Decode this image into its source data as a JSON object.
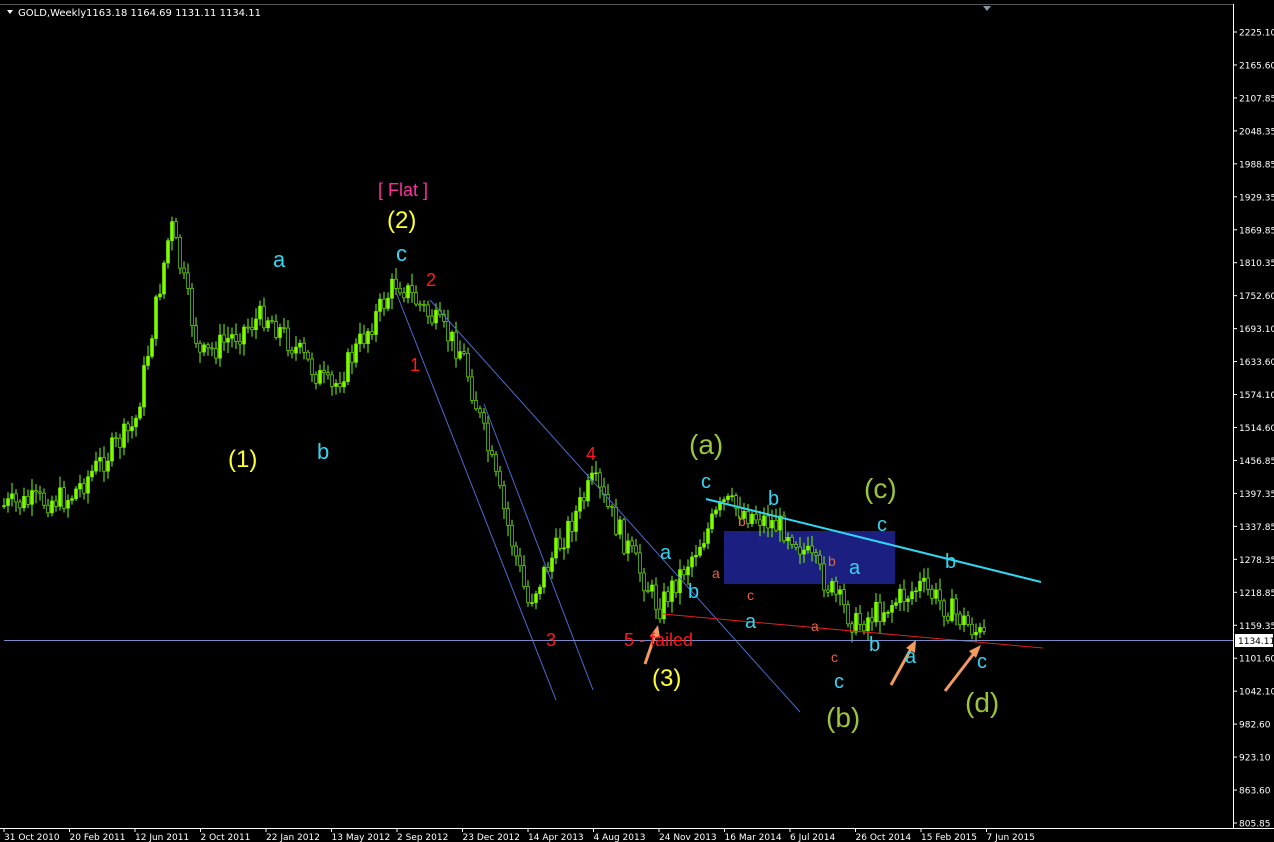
{
  "window": {
    "symbol_label": "GOLD,Weekly",
    "ohlc_label": "1163.18 1164.69 1131.11 1134.11"
  },
  "colors": {
    "background": "#000000",
    "candles": "#7CFC00",
    "axis": "#FFFFFF",
    "cyan": "#33D6F2",
    "red": "#FF1A1A",
    "yellow": "#FFFF33",
    "olive": "#9BC53D",
    "pink": "#FF2FA0",
    "orange": "#F29A5F",
    "blue_line": "#4A6CD0",
    "channel_fill": "#1A1F80",
    "price_line": "#7A8CC8"
  },
  "chart_data": {
    "type": "candlestick",
    "title": "GOLD,Weekly",
    "y_axis": {
      "ticks": [
        "2225.10",
        "2165.60",
        "2107.85",
        "2048.35",
        "1988.85",
        "1929.35",
        "1869.85",
        "1810.35",
        "1752.60",
        "1693.10",
        "1633.60",
        "1574.10",
        "1514.60",
        "1456.85",
        "1397.35",
        "1337.85",
        "1278.35",
        "1218.85",
        "1159.35",
        "1101.60",
        "1042.10",
        "982.60",
        "923.10",
        "863.60",
        "805.85"
      ],
      "ylim": [
        805.85,
        2225.1
      ]
    },
    "x_axis": {
      "ticks": [
        "31 Oct 2010",
        "20 Feb 2011",
        "12 Jun 2011",
        "2 Oct 2011",
        "22 Jan 2012",
        "13 May 2012",
        "2 Sep 2012",
        "23 Dec 2012",
        "14 Apr 2013",
        "4 Aug 2013",
        "24 Nov 2013",
        "16 Mar 2014",
        "6 Jul 2014",
        "26 Oct 2014",
        "15 Feb 2015",
        "7 Jun 2015"
      ]
    },
    "current_price": "1134.11",
    "price_path": [
      {
        "date": "31 Oct 2010",
        "close": 1375
      },
      {
        "date": "20 Feb 2011",
        "close": 1390
      },
      {
        "date": "12 Jun 2011",
        "close": 1520
      },
      {
        "date": "Sep 2011",
        "close": 1880
      },
      {
        "date": "2 Oct 2011",
        "close": 1640
      },
      {
        "date": "22 Jan 2012",
        "close": 1720
      },
      {
        "date": "13 May 2012",
        "close": 1580
      },
      {
        "date": "2 Sep 2012",
        "close": 1780
      },
      {
        "date": "23 Dec 2012",
        "close": 1650
      },
      {
        "date": "14 Apr 2013",
        "close": 1200
      },
      {
        "date": "4 Aug 2013",
        "close": 1420
      },
      {
        "date": "24 Nov 2013",
        "close": 1190
      },
      {
        "date": "16 Mar 2014",
        "close": 1380
      },
      {
        "date": "6 Jul 2014",
        "close": 1330
      },
      {
        "date": "26 Oct 2014",
        "close": 1160
      },
      {
        "date": "15 Feb 2015",
        "close": 1230
      },
      {
        "date": "7 Jun 2015",
        "close": 1134
      }
    ],
    "annotations": {
      "flat": "[ Flat ]",
      "wave_1": "(1)",
      "wave_2": "(2)",
      "wave_3": "(3)",
      "wave_a": "(a)",
      "wave_b": "(b)",
      "wave_c": "(c)",
      "wave_d": "(d)",
      "a": "a",
      "b": "b",
      "c": "c",
      "n1": "1",
      "n2": "2",
      "n3": "3",
      "n4": "4",
      "five_failed": "5 - failed"
    }
  }
}
